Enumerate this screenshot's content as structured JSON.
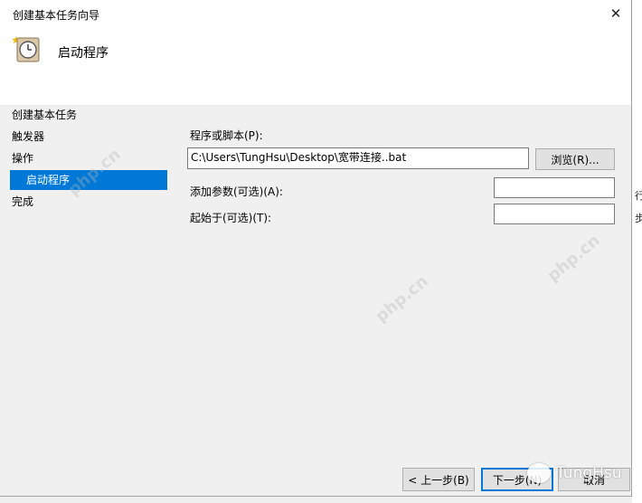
{
  "window": {
    "title": "创建基本任务向导",
    "close_glyph": "✕"
  },
  "header": {
    "title": "启动程序",
    "icon": "clock-task-icon"
  },
  "nav": {
    "items": [
      {
        "label": "创建基本任务"
      },
      {
        "label": "触发器"
      },
      {
        "label": "操作"
      },
      {
        "label": "启动程序"
      },
      {
        "label": "完成"
      }
    ],
    "selected_index": 3
  },
  "form": {
    "program_label": "程序或脚本(P):",
    "program_value": "C:\\Users\\TungHsu\\Desktop\\宽带连接..bat",
    "browse_label": "浏览(R)...",
    "args_label": "添加参数(可选)(A):",
    "args_value": "",
    "startin_label": "起始于(可选)(T):",
    "startin_value": ""
  },
  "footer": {
    "back_label": "< 上一步(B)",
    "next_label": "下一步(N)",
    "cancel_label": "取消"
  },
  "right_strip": {
    "chars": [
      "行",
      "步"
    ]
  },
  "watermark": {
    "site": "php.cn",
    "badge": "TungHsu"
  },
  "colors": {
    "selection": "#0078d7",
    "dialog_bg": "#f0f0f0",
    "header_bg": "#ffffff"
  }
}
